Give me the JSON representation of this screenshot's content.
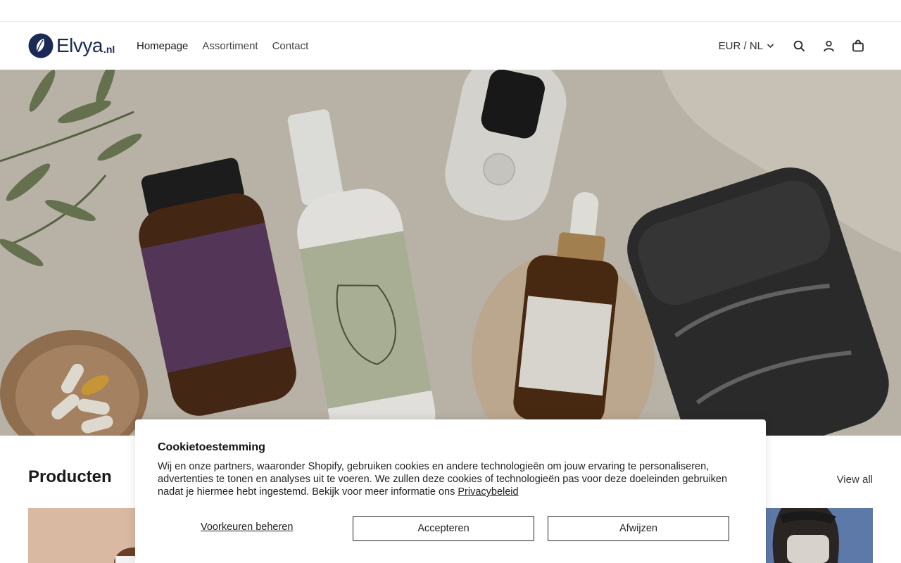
{
  "brand": {
    "name": "Elvya",
    "tld": ".nl",
    "color": "#1b2a55"
  },
  "nav": {
    "items": [
      {
        "label": "Homepage"
      },
      {
        "label": "Assortiment"
      },
      {
        "label": "Contact"
      }
    ]
  },
  "header": {
    "locale": "EUR / NL",
    "icons": [
      "chevron-down-icon",
      "search-icon",
      "account-icon",
      "cart-icon"
    ]
  },
  "products": {
    "title": "Producten",
    "view_all": "View all"
  },
  "cookie": {
    "title": "Cookietoestemming",
    "text": "Wij en onze partners, waaronder Shopify, gebruiken cookies en andere technologieën om jouw ervaring te personaliseren, advertenties te tonen en analyses uit te voeren. We zullen deze cookies of technologieën pas voor deze doeleinden gebruiken nadat je hiermee hebt ingestemd. Bekijk voor meer informatie ons",
    "policy_link": "Privacybeleid",
    "manage": "Voorkeuren beheren",
    "accept": "Accepteren",
    "decline": "Afwijzen"
  }
}
